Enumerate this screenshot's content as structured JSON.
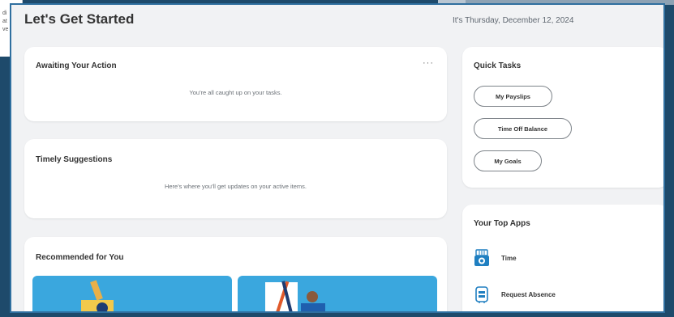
{
  "background": {
    "side_text_lines": [
      "di",
      "at",
      "ve"
    ]
  },
  "header": {
    "title": "Let's Get Started",
    "date": "It's Thursday, December 12, 2024"
  },
  "awaiting": {
    "title": "Awaiting Your Action",
    "message": "You're all caught up on your tasks.",
    "more_label": "···"
  },
  "suggestions": {
    "title": "Timely Suggestions",
    "message": "Here's where you'll get updates on your active items."
  },
  "recommended": {
    "title": "Recommended for You"
  },
  "quick_tasks": {
    "title": "Quick Tasks",
    "buttons": [
      "My Payslips",
      "Time Off Balance",
      "My Goals"
    ]
  },
  "top_apps": {
    "title": "Your Top Apps",
    "apps": [
      {
        "label": "Time",
        "icon": "clock-calendar-icon"
      },
      {
        "label": "Request Absence",
        "icon": "suitcase-icon"
      }
    ]
  },
  "colors": {
    "accent": "#1f7fc1",
    "card_image": "#3aa7de",
    "frame": "#2f6f9f"
  }
}
